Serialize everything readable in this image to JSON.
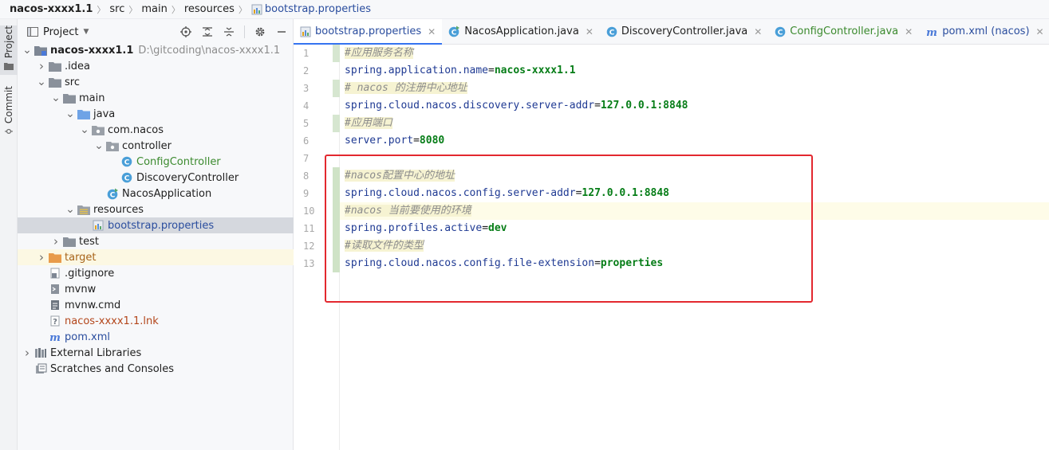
{
  "breadcrumb": {
    "project": "nacos-xxxx1.1",
    "parts": [
      "src",
      "main",
      "resources"
    ],
    "file": "bootstrap.properties"
  },
  "tool_strip": {
    "project_tab": "Project",
    "commit_tab": "Commit"
  },
  "project_panel": {
    "title": "Project",
    "tree": [
      {
        "label": "nacos-xxxx1.1",
        "note": "D:\\gitcoding\\nacos-xxxx1.1",
        "icon": "module-folder-icon",
        "expanded": true,
        "depth": 0
      },
      {
        "label": ".idea",
        "icon": "folder-icon",
        "expanded": false,
        "depth": 1
      },
      {
        "label": "src",
        "icon": "folder-icon",
        "expanded": true,
        "depth": 1
      },
      {
        "label": "main",
        "icon": "folder-icon",
        "expanded": true,
        "depth": 2
      },
      {
        "label": "java",
        "icon": "source-folder-icon",
        "expanded": true,
        "depth": 3
      },
      {
        "label": "com.nacos",
        "icon": "package-icon",
        "expanded": true,
        "depth": 4
      },
      {
        "label": "controller",
        "icon": "package-icon",
        "expanded": true,
        "depth": 5
      },
      {
        "label": "ConfigController",
        "icon": "java-class-icon",
        "depth": 6,
        "color": "#3b8a2e"
      },
      {
        "label": "DiscoveryController",
        "icon": "java-class-icon",
        "depth": 6
      },
      {
        "label": "NacosApplication",
        "icon": "spring-app-icon",
        "depth": 5
      },
      {
        "label": "resources",
        "icon": "resources-folder-icon",
        "expanded": true,
        "depth": 3
      },
      {
        "label": "bootstrap.properties",
        "icon": "properties-file-icon",
        "depth": 4,
        "selected": true,
        "color": "#2a4d9e"
      },
      {
        "label": "test",
        "icon": "folder-icon",
        "expanded": false,
        "depth": 2
      },
      {
        "label": "target",
        "icon": "excluded-folder-icon",
        "expanded": false,
        "depth": 1,
        "excluded": true,
        "color": "#a8641a"
      },
      {
        "label": ".gitignore",
        "icon": "gitignore-file-icon",
        "depth": 1
      },
      {
        "label": "mvnw",
        "icon": "script-file-icon",
        "depth": 1
      },
      {
        "label": "mvnw.cmd",
        "icon": "text-file-icon",
        "depth": 1
      },
      {
        "label": "nacos-xxxx1.1.lnk",
        "icon": "unknown-file-icon",
        "depth": 1,
        "color": "#b3461b"
      },
      {
        "label": "pom.xml",
        "icon": "maven-icon",
        "depth": 1,
        "color": "#2a4d9e"
      },
      {
        "label": "External Libraries",
        "icon": "libraries-icon",
        "expanded": false,
        "depth": 0
      },
      {
        "label": "Scratches and Consoles",
        "icon": "scratches-icon",
        "depth": 0
      }
    ]
  },
  "editor_tabs": [
    {
      "label": "bootstrap.properties",
      "icon": "properties-file-icon",
      "active": true,
      "color": "#2a4d9e"
    },
    {
      "label": "NacosApplication.java",
      "icon": "spring-app-icon",
      "active": false
    },
    {
      "label": "DiscoveryController.java",
      "icon": "java-class-icon",
      "active": false
    },
    {
      "label": "ConfigController.java",
      "icon": "java-class-icon",
      "active": false,
      "color": "#3b8a2e"
    },
    {
      "label": "pom.xml (nacos)",
      "icon": "maven-icon",
      "active": false,
      "color": "#2a4d9e"
    }
  ],
  "editor": {
    "lines": [
      {
        "n": "1",
        "type": "comment",
        "text": "#应用服务名称",
        "cmt_hl": true
      },
      {
        "n": "2",
        "type": "prop",
        "key": "spring.application.name",
        "value": "nacos-xxxx1.1"
      },
      {
        "n": "3",
        "type": "comment",
        "text": "# nacos 的注册中心地址",
        "cmt_hl": true
      },
      {
        "n": "4",
        "type": "prop",
        "key": "spring.cloud.nacos.discovery.server-addr",
        "value": "127.0.0.1:8848"
      },
      {
        "n": "5",
        "type": "comment",
        "text": "#应用端口",
        "cmt_hl": true
      },
      {
        "n": "6",
        "type": "prop",
        "key": "server.port",
        "value": "8080"
      },
      {
        "n": "7",
        "type": "blank"
      },
      {
        "n": "8",
        "type": "comment",
        "text": "#nacos配置中心的地址",
        "cmt_hl": true
      },
      {
        "n": "9",
        "type": "prop",
        "key": "spring.cloud.nacos.config.server-addr",
        "value": "127.0.0.1:8848"
      },
      {
        "n": "10",
        "type": "comment",
        "text": "#nacos 当前要使用的环境",
        "cmt_hl": true,
        "current": true
      },
      {
        "n": "11",
        "type": "prop",
        "key": "spring.profiles.active",
        "value": "dev"
      },
      {
        "n": "12",
        "type": "comment",
        "text": "#读取文件的类型",
        "cmt_hl": true
      },
      {
        "n": "13",
        "type": "prop",
        "key": "spring.cloud.nacos.config.file-extension",
        "value": "properties"
      }
    ]
  },
  "colors": {
    "accent": "#3574f0",
    "annotation_box": "#e3282f",
    "property_key": "#1f3a93",
    "property_value": "#067d17",
    "comment": "#8c8c8c"
  }
}
